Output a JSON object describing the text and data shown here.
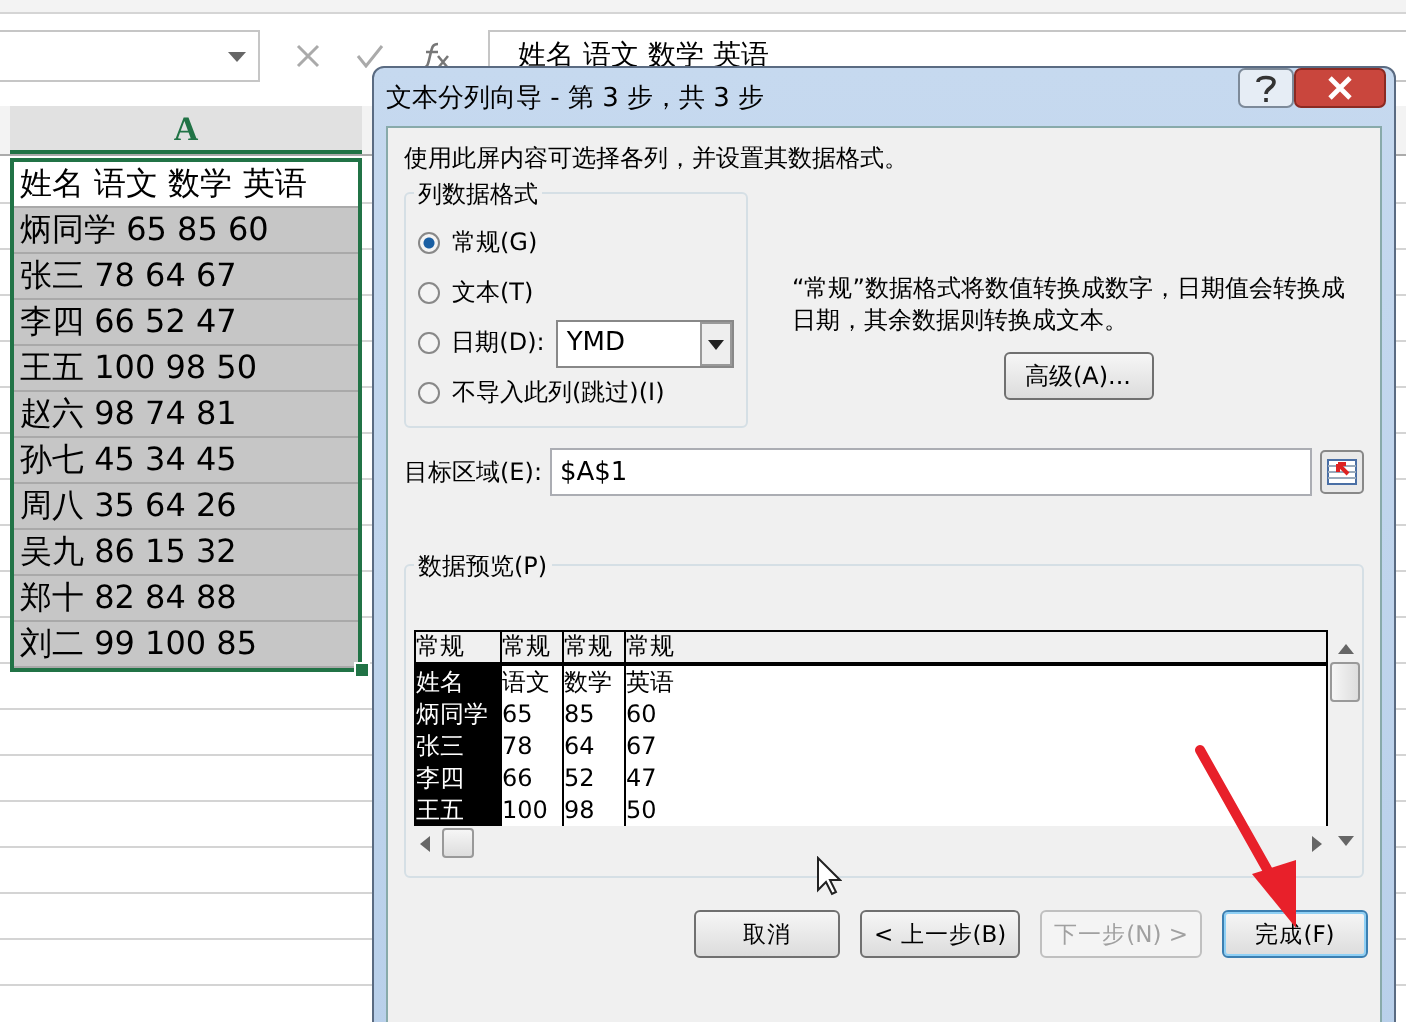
{
  "formula_bar": {
    "formula": "姓名 语文 数学 英语"
  },
  "sheet": {
    "column_header": "A",
    "rows": [
      {
        "text": "姓名 语文 数学 英语",
        "active": true
      },
      {
        "text": "炳同学 65 85 60",
        "active": false
      },
      {
        "text": "张三 78 64 67",
        "active": false
      },
      {
        "text": "李四 66 52 47",
        "active": false
      },
      {
        "text": "王五 100 98 50",
        "active": false
      },
      {
        "text": "赵六 98 74 81",
        "active": false
      },
      {
        "text": "孙七 45 34 45",
        "active": false
      },
      {
        "text": "周八 35 64 26",
        "active": false
      },
      {
        "text": "吴九 86 15 32",
        "active": false
      },
      {
        "text": "郑十 82 84 88",
        "active": false
      },
      {
        "text": "刘二 99 100 85",
        "active": false
      }
    ]
  },
  "dialog": {
    "title": "文本分列向导 - 第 3 步，共 3 步",
    "instruction": "使用此屏内容可选择各列，并设置其数据格式。",
    "format_group": {
      "label": "列数据格式",
      "options": [
        {
          "label": "常规(G)",
          "selected": true,
          "kind": "radio"
        },
        {
          "label": "文本(T)",
          "selected": false,
          "kind": "radio"
        },
        {
          "label": "日期(D):",
          "selected": false,
          "kind": "date"
        },
        {
          "label": "不导入此列(跳过)(I)",
          "selected": false,
          "kind": "radio"
        }
      ],
      "date_format": "YMD"
    },
    "description": "“常规”数据格式将数值转换成数字，日期值会转换成日期，其余数据则转换成文本。",
    "advanced_button": "高级(A)...",
    "target": {
      "label": "目标区域(E):",
      "value": "$A$1"
    },
    "preview": {
      "label": "数据预览(P)",
      "columns": [
        {
          "format": "常规",
          "selected": true,
          "cells": [
            "姓名",
            "炳同学",
            "张三",
            "李四",
            "王五"
          ]
        },
        {
          "format": "常规",
          "selected": false,
          "cells": [
            "语文",
            "65",
            "78",
            "66",
            "100"
          ]
        },
        {
          "format": "常规",
          "selected": false,
          "cells": [
            "数学",
            "85",
            "64",
            "52",
            "98"
          ]
        },
        {
          "format": "常规",
          "selected": false,
          "cells": [
            "英语",
            "60",
            "67",
            "47",
            "50"
          ]
        }
      ]
    },
    "buttons": [
      {
        "label": "取消",
        "disabled": false,
        "focused": false
      },
      {
        "label": "< 上一步(B)",
        "disabled": false,
        "focused": false
      },
      {
        "label": "下一步(N) >",
        "disabled": true,
        "focused": false
      },
      {
        "label": "完成(F)",
        "disabled": false,
        "focused": true
      }
    ]
  }
}
